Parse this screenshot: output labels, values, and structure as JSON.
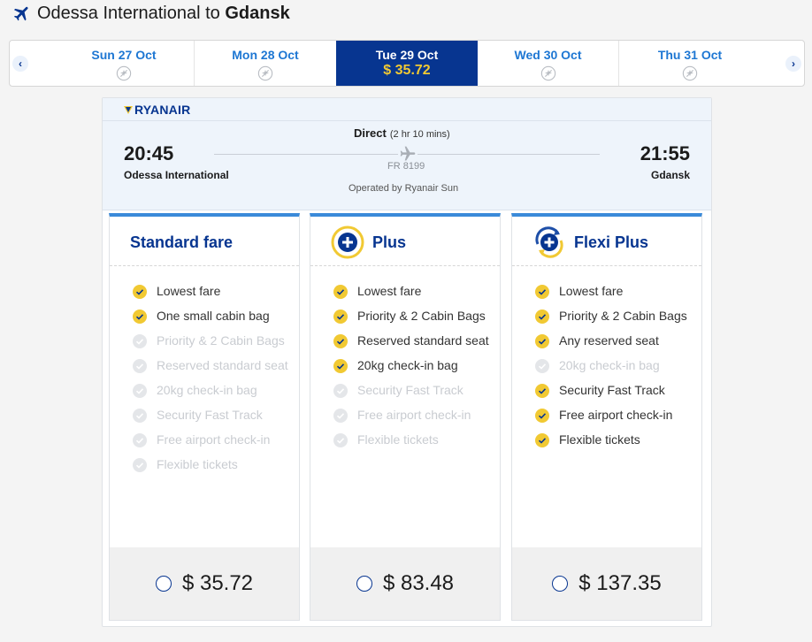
{
  "header": {
    "origin": "Odessa International to ",
    "destination": "Gdansk",
    "icon": "plane-icon"
  },
  "carousel": {
    "days": [
      {
        "label": "Sun 27 Oct",
        "available": false
      },
      {
        "label": "Mon 28 Oct",
        "available": false
      },
      {
        "label": "Tue 29 Oct",
        "price": "$ 35.72",
        "selected": true
      },
      {
        "label": "Wed 30 Oct",
        "available": false
      },
      {
        "label": "Thu 31 Oct",
        "available": false
      }
    ],
    "prev_icon": "chevron-left-icon",
    "next_icon": "chevron-right-icon"
  },
  "flight": {
    "airline": "RYANAIR",
    "departure_time": "20:45",
    "departure_airport": "Odessa International",
    "arrival_time": "21:55",
    "arrival_airport": "Gdansk",
    "type": "Direct",
    "duration": "(2 hr 10 mins)",
    "flight_number": "FR 8199",
    "operated_by": "Operated by Ryanair Sun"
  },
  "fares": [
    {
      "name": "Standard fare",
      "price": "$ 35.72",
      "features": [
        {
          "text": "Lowest fare",
          "included": true
        },
        {
          "text": "One small cabin bag",
          "included": true
        },
        {
          "text": "Priority & 2 Cabin Bags",
          "included": false
        },
        {
          "text": "Reserved standard seat",
          "included": false
        },
        {
          "text": "20kg check-in bag",
          "included": false
        },
        {
          "text": "Security Fast Track",
          "included": false
        },
        {
          "text": "Free airport check-in",
          "included": false
        },
        {
          "text": "Flexible tickets",
          "included": false
        }
      ]
    },
    {
      "name": "Plus",
      "price": "$ 83.48",
      "badge": "plus-badge-icon",
      "features": [
        {
          "text": "Lowest fare",
          "included": true
        },
        {
          "text": "Priority & 2 Cabin Bags",
          "included": true
        },
        {
          "text": "Reserved standard seat",
          "included": true
        },
        {
          "text": "20kg check-in bag",
          "included": true
        },
        {
          "text": "Security Fast Track",
          "included": false
        },
        {
          "text": "Free airport check-in",
          "included": false
        },
        {
          "text": "Flexible tickets",
          "included": false
        }
      ]
    },
    {
      "name": "Flexi Plus",
      "price": "$ 137.35",
      "badge": "flexi-plus-badge-icon",
      "features": [
        {
          "text": "Lowest fare",
          "included": true
        },
        {
          "text": "Priority & 2 Cabin Bags",
          "included": true
        },
        {
          "text": "Any reserved seat",
          "included": true
        },
        {
          "text": "20kg check-in bag",
          "included": false
        },
        {
          "text": "Security Fast Track",
          "included": true
        },
        {
          "text": "Free airport check-in",
          "included": true
        },
        {
          "text": "Flexible tickets",
          "included": true
        }
      ]
    }
  ],
  "colors": {
    "brand_navy": "#073590",
    "accent_yellow": "#f1c933",
    "link_blue": "#1e77d3",
    "fare_border": "#3a8ad9",
    "disabled_text": "#c9ccd1"
  }
}
